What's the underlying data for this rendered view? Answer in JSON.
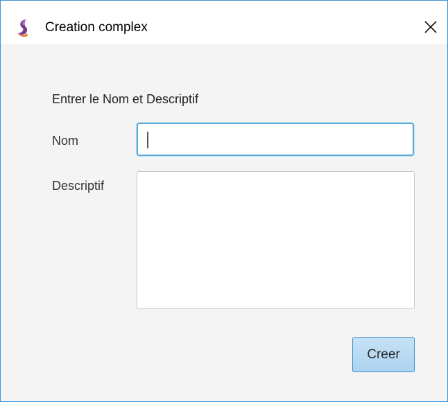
{
  "window": {
    "title": "Creation complex",
    "icon": "app-logo-icon",
    "close_icon": "close-icon"
  },
  "form": {
    "heading": "Entrer le Nom et Descriptif",
    "nom_label": "Nom",
    "nom_value": "",
    "descriptif_label": "Descriptif",
    "descriptif_value": "",
    "submit_label": "Creer"
  },
  "colors": {
    "window_border": "#3c93d8",
    "focus_border": "#5aa9d6",
    "button_fill": "#b8daf2",
    "button_border": "#3f8ec8",
    "icon_purple": "#7a3a8c",
    "icon_orange": "#e07a1f"
  }
}
